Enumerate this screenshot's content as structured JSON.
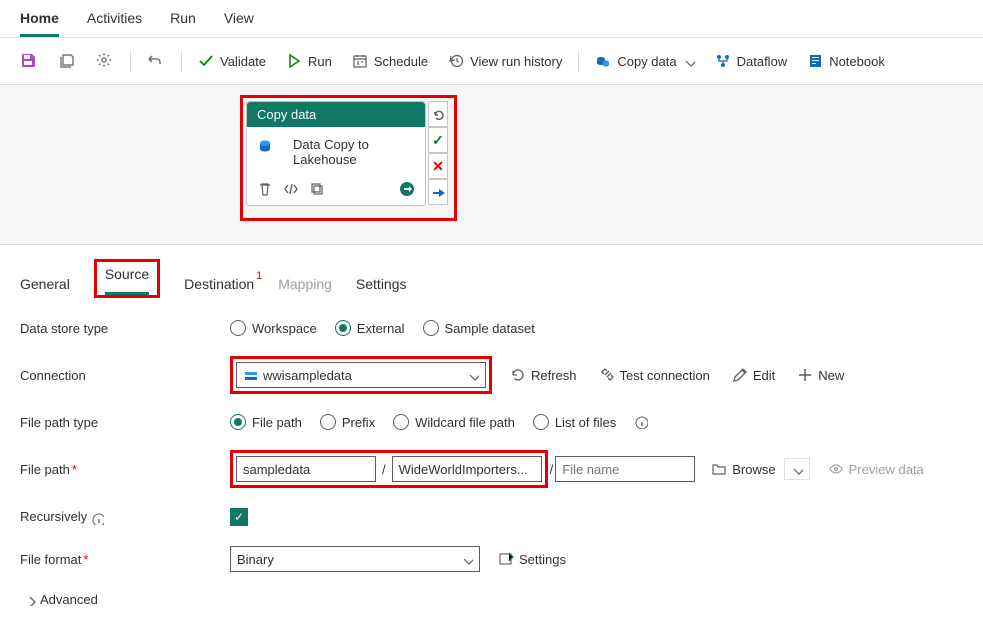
{
  "top_menu": {
    "items": [
      "Home",
      "Activities",
      "Run",
      "View"
    ],
    "active": "Home"
  },
  "toolbar": {
    "validate": "Validate",
    "run": "Run",
    "schedule": "Schedule",
    "history": "View run history",
    "copydata": "Copy data",
    "dataflow": "Dataflow",
    "notebook": "Notebook"
  },
  "activity": {
    "title": "Copy data",
    "line1": "Data Copy to",
    "line2": "Lakehouse"
  },
  "bottom_tabs": {
    "general": "General",
    "source": "Source",
    "destination": "Destination",
    "dest_badge": "1",
    "mapping": "Mapping",
    "settings": "Settings"
  },
  "form": {
    "data_store_type_label": "Data store type",
    "dst_workspace": "Workspace",
    "dst_external": "External",
    "dst_sample": "Sample dataset",
    "connection_label": "Connection",
    "connection_value": "wwisampledata",
    "refresh": "Refresh",
    "test_conn": "Test connection",
    "edit": "Edit",
    "new": "New",
    "file_path_type_label": "File path type",
    "fpt_filepath": "File path",
    "fpt_prefix": "Prefix",
    "fpt_wildcard": "Wildcard file path",
    "fpt_list": "List of files",
    "file_path_label": "File path",
    "container_value": "sampledata",
    "directory_value": "WideWorldImporters...",
    "filename_placeholder": "File name",
    "browse": "Browse",
    "preview": "Preview data",
    "recursively_label": "Recursively",
    "file_format_label": "File format",
    "file_format_value": "Binary",
    "ff_settings": "Settings",
    "advanced": "Advanced"
  }
}
